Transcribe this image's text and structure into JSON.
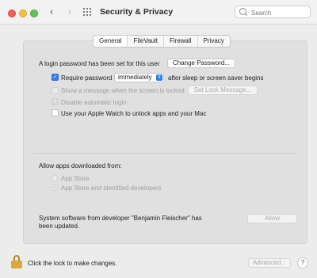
{
  "window": {
    "title": "Security & Privacy",
    "nav_back": "‹",
    "nav_forward": "›"
  },
  "search": {
    "placeholder": "Search"
  },
  "tabs": [
    {
      "label": "General",
      "active": true
    },
    {
      "label": "FileVault",
      "active": false
    },
    {
      "label": "Firewall",
      "active": false
    },
    {
      "label": "Privacy",
      "active": false
    }
  ],
  "general": {
    "login_password_text": "A login password has been set for this user",
    "change_password_label": "Change Password...",
    "require_password": {
      "label": "Require password",
      "checked": true,
      "selected_option": "immediately",
      "suffix": "after sleep or screen saver begins"
    },
    "show_message": {
      "label": "Show a message when the screen is locked",
      "checked": false,
      "enabled": false,
      "button_label": "Set Lock Message..."
    },
    "disable_auto_login": {
      "label": "Disable automatic login",
      "checked": true,
      "enabled": false
    },
    "apple_watch": {
      "label": "Use your Apple Watch to unlock apps and your Mac",
      "checked": false
    }
  },
  "downloads": {
    "heading": "Allow apps downloaded from:",
    "options": [
      {
        "label": "App Store",
        "selected": false
      },
      {
        "label": "App Store and identified developers",
        "selected": true
      }
    ]
  },
  "system_software": {
    "line1": "System software from developer \"Benjamin Fleischer\" has",
    "line2": "been updated.",
    "allow_label": "Allow"
  },
  "footer": {
    "lock_text": "Click the lock to make changes.",
    "advanced_label": "Advanced...",
    "help_label": "?"
  },
  "colors": {
    "accent": "#2d7cf6",
    "close": "#f25f58",
    "minimize": "#f8be3b",
    "zoom": "#5fc454",
    "lock": "#dca73f"
  }
}
